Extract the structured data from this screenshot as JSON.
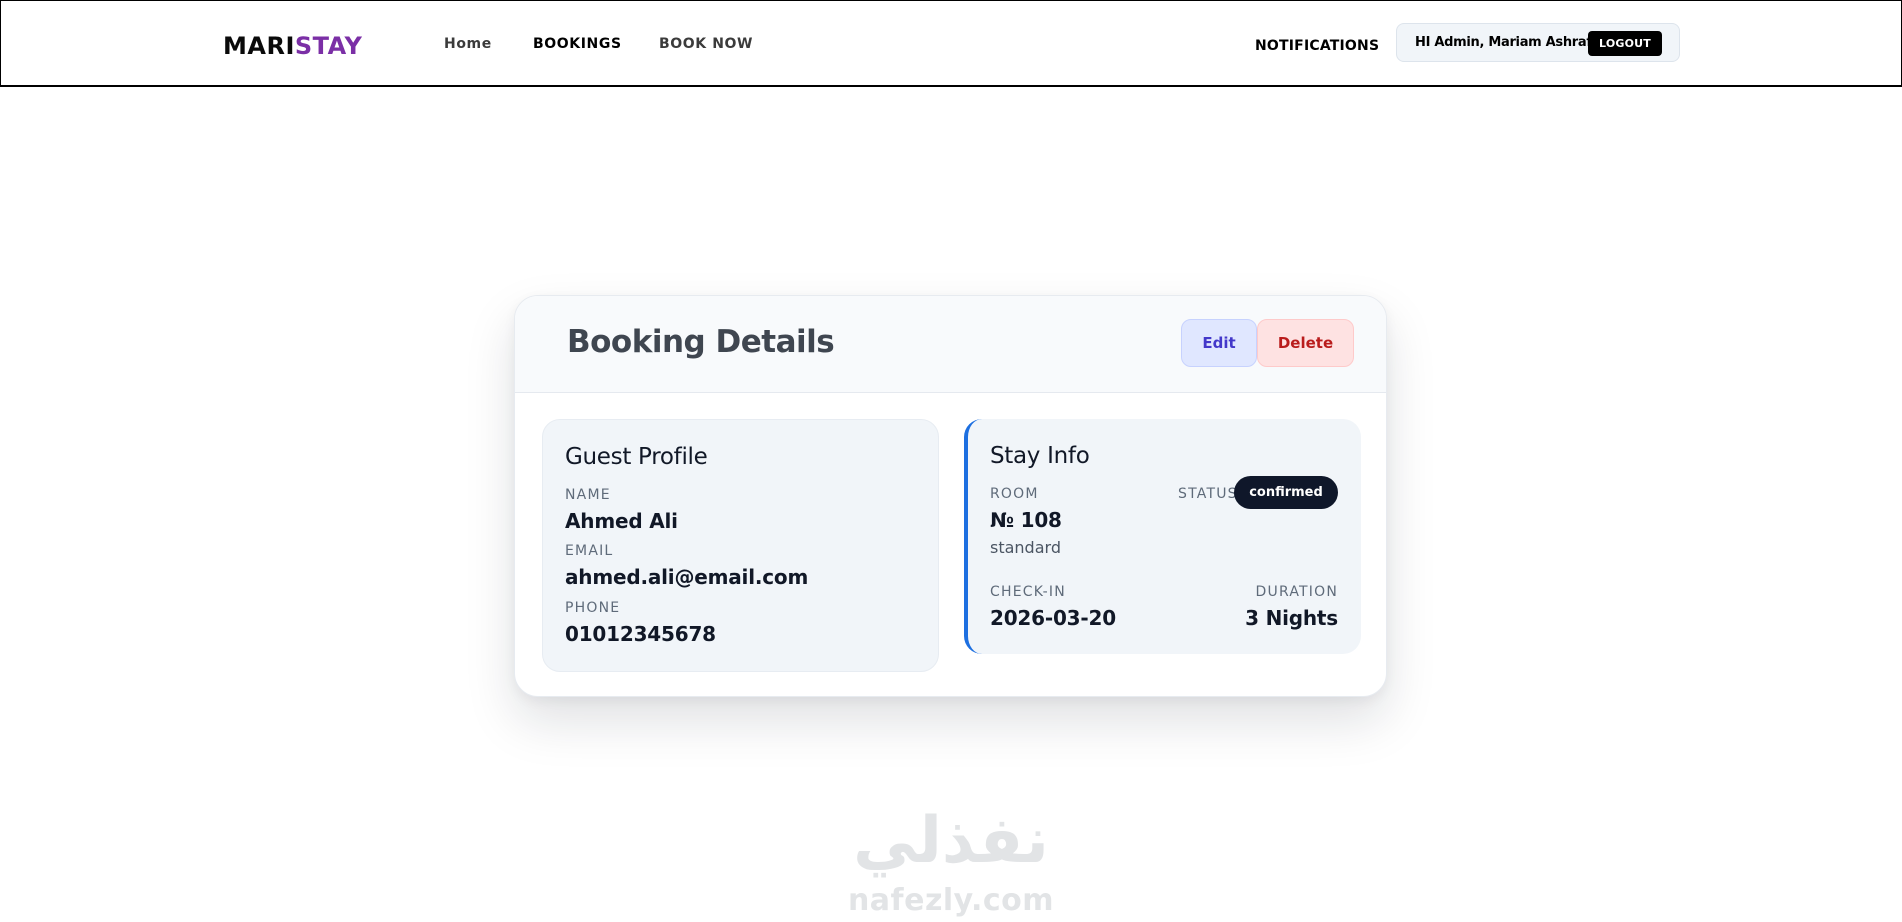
{
  "header": {
    "logo_part1": "MARI",
    "logo_part2": "STAY",
    "nav": {
      "home": "Home",
      "bookings": "BOOKINGS",
      "book_now": "BOOK NOW",
      "notifications": "NOTIFICATIONS"
    },
    "greeting": "HI Admin, Mariam Ashraf",
    "logout_label": "LOGOUT"
  },
  "booking": {
    "title": "Booking Details",
    "edit_label": "Edit",
    "delete_label": "Delete",
    "guest": {
      "title": "Guest Profile",
      "name_label": "NAME",
      "name": "Ahmed Ali",
      "email_label": "EMAIL",
      "email": "ahmed.ali@email.com",
      "phone_label": "PHONE",
      "phone": "01012345678"
    },
    "stay": {
      "title": "Stay Info",
      "room_label": "ROOM",
      "room": "№ 108",
      "room_type": "standard",
      "status_label": "STATUS",
      "status": "confirmed",
      "checkin_label": "CHECK-IN",
      "checkin": "2026-03-20",
      "duration_label": "DURATION",
      "duration": "3 Nights"
    }
  },
  "watermark": {
    "arabic": "نفذلي",
    "latin": "nafezly.com"
  },
  "colors": {
    "brand_purple": "#7b2fa6",
    "stay_accent": "#1d6fe0",
    "edit_bg": "#e0e7ff",
    "delete_bg": "#fee2e2",
    "badge_bg": "#0f172a"
  }
}
